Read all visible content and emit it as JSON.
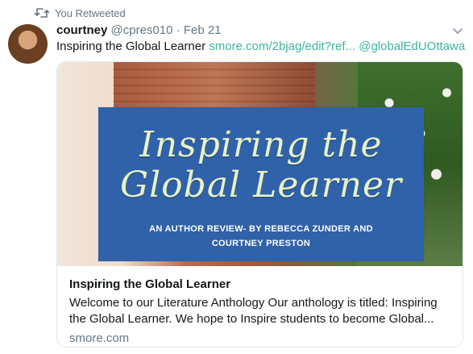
{
  "retweet": {
    "icon": "retweet-icon",
    "label": "You Retweeted"
  },
  "tweet": {
    "author_name": "courtney",
    "handle": "@cpres010",
    "separator": "·",
    "date": "Feb 21",
    "text": "Inspiring the Global Learner",
    "link_url": "smore.com/2bjag/edit?ref...",
    "mention": "@globalEdUOttawa",
    "caret_icon": "chevron-down-icon"
  },
  "card": {
    "image": {
      "title_line1": "Inspiring the",
      "title_line2": "Global Learner",
      "subtitle": "AN AUTHOR REVIEW- BY REBECCA ZUNDER AND COURTNEY PRESTON"
    },
    "title": "Inspiring the Global Learner",
    "description": "Welcome to our Literature Anthology Our anthology is titled: Inspiring the Global Learner. We hope to Inspire students to become Global...",
    "domain": "smore.com"
  },
  "colors": {
    "link": "#3bb5a0",
    "muted": "#657786",
    "banner": "#2f62a8",
    "banner_title": "#e8f2c4"
  }
}
